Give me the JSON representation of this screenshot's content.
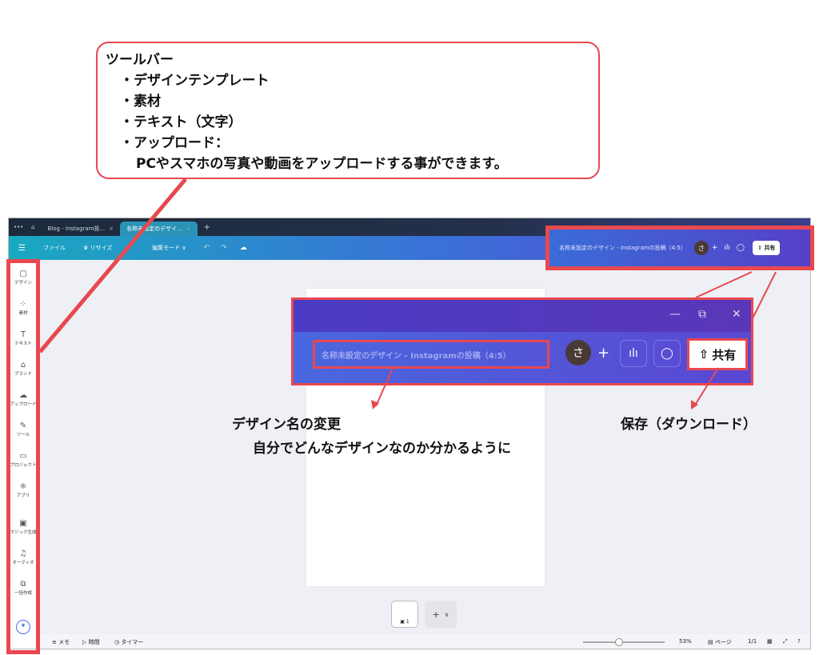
{
  "callout": {
    "title": "ツールバー",
    "items": [
      "・デザインテンプレート",
      "・素材",
      "・テキスト（文字）",
      "・アップロード："
    ],
    "detail": "PCやスマホの写真や動画をアップロードする事ができます。"
  },
  "tabs": [
    {
      "label": "Blog - Instagram投...",
      "close": "×"
    },
    {
      "label": "名称未設定のデザイ...",
      "close": "×"
    }
  ],
  "header": {
    "file": "ファイル",
    "resize": "♛ リサイズ",
    "mode": "編集モード ∨"
  },
  "sidebar": {
    "items": [
      {
        "label": "デザイン",
        "icon": "▢"
      },
      {
        "label": "素材",
        "icon": "⁘"
      },
      {
        "label": "テキスト",
        "icon": "T"
      },
      {
        "label": "ブランド",
        "icon": "⌂"
      },
      {
        "label": "アップロード",
        "icon": "☁"
      },
      {
        "label": "ツール",
        "icon": "✎"
      },
      {
        "label": "プロジェクト",
        "icon": "▭"
      },
      {
        "label": "アプリ",
        "icon": "⁜"
      },
      {
        "label": "マジック生成",
        "icon": "▣"
      },
      {
        "label": "オーディオ",
        "icon": "♫"
      },
      {
        "label": "一括作成",
        "icon": "⧉"
      }
    ]
  },
  "design_title": "名称未設定のデザイン - Instagramの投稿（4:5）",
  "avatar_letter": "さ",
  "share_label": "共有",
  "page_thumb_label": "▣ 1",
  "bottom": {
    "memo": "メモ",
    "time": "時間",
    "timer": "タイマー",
    "zoom": "53%",
    "page": "ページ",
    "page_count": "1/1"
  },
  "annotations": {
    "rename_title": "デザイン名の変更",
    "rename_desc": "自分でどんなデザインなのか分かるように",
    "save_label": "保存（ダウンロード）"
  },
  "colors": {
    "highlight": "#e8484f",
    "header_start": "#1aa8c0",
    "header_end": "#5a3fc9"
  }
}
